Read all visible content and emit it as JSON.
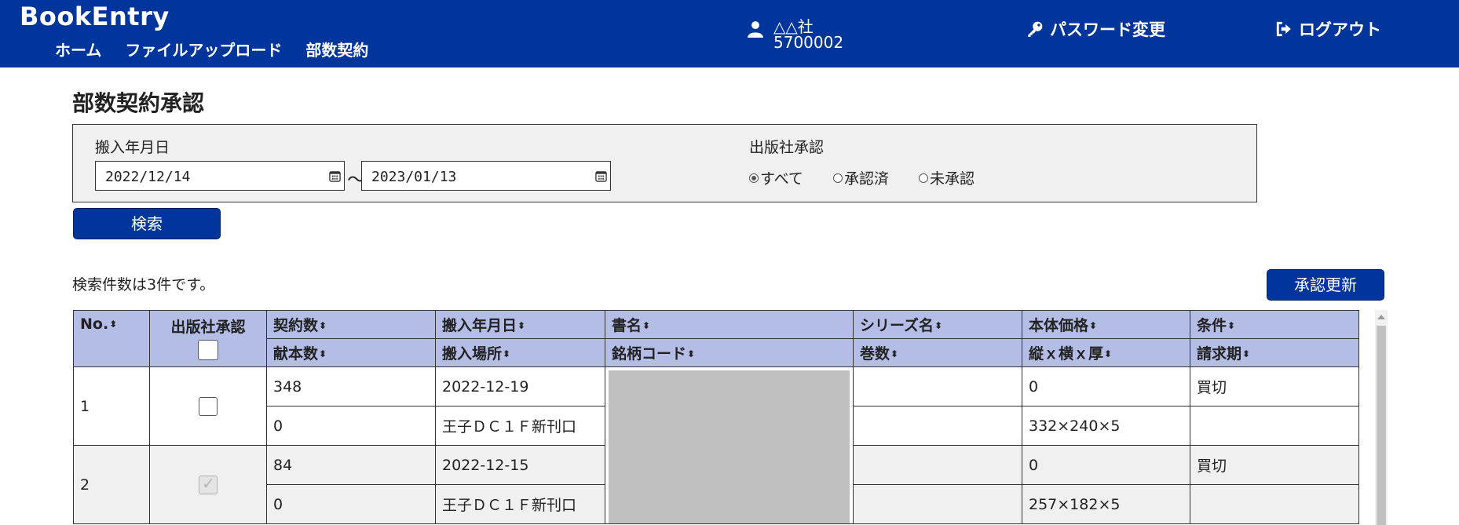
{
  "header": {
    "brand": "BookEntry",
    "nav": [
      "ホーム",
      "ファイルアップロード",
      "部数契約"
    ],
    "user_name": "△△社",
    "user_code": "5700002",
    "change_password": "パスワード変更",
    "logout": "ログアウト"
  },
  "page": {
    "title": "部数契約承認"
  },
  "search": {
    "date_label": "搬入年月日",
    "date_from": "2022/12/14",
    "tilde": "～",
    "date_to": "2023/01/13",
    "approval_label": "出版社承認",
    "radio": [
      {
        "label": "すべて",
        "checked": true
      },
      {
        "label": "承認済",
        "checked": false
      },
      {
        "label": "未承認",
        "checked": false
      }
    ],
    "button": "検索"
  },
  "result_count": "検索件数は3件です。",
  "update_button": "承認更新",
  "table": {
    "headers_row1": [
      "No.",
      "出版社承認",
      "契約数",
      "搬入年月日",
      "書名",
      "シリーズ名",
      "本体価格",
      "条件"
    ],
    "headers_row2": [
      "献本数",
      "搬入場所",
      "銘柄コード",
      "巻数",
      "縦ｘ横ｘ厚",
      "請求期"
    ],
    "sort_icon": "⬍",
    "rows": [
      {
        "no": "1",
        "approved": false,
        "disabled": false,
        "contract": "348",
        "date": "2022-12-19",
        "title": "",
        "series": "",
        "price": "0",
        "condition": "買切",
        "gift": "0",
        "place": "王子ＤＣ１Ｆ新刊口",
        "code": "",
        "volume": "",
        "size": "332×240×5",
        "billing": ""
      },
      {
        "no": "2",
        "approved": true,
        "disabled": true,
        "contract": "84",
        "date": "2022-12-15",
        "title": "",
        "series": "",
        "price": "0",
        "condition": "買切",
        "gift": "0",
        "place": "王子ＤＣ１Ｆ新刊口",
        "code": "",
        "volume": "",
        "size": "257×182×5",
        "billing": ""
      }
    ]
  },
  "colors": {
    "header_bg": "#00359c",
    "table_header_bg": "#b3bde6",
    "redacted": "#c0c0c0"
  }
}
